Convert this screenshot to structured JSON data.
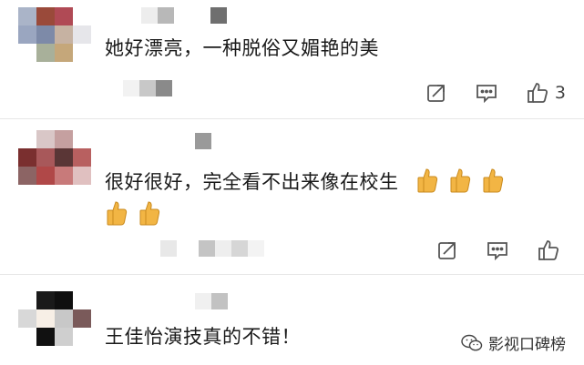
{
  "comments": [
    {
      "text": "她好漂亮，一种脱俗又媚艳的美",
      "likes": "3",
      "thumb_emojis": 0
    },
    {
      "text": "很好很好，完全看不出来像在校生",
      "likes": "",
      "thumb_emojis": 5
    },
    {
      "text": "王佳怡演技真的不错！",
      "likes": "",
      "thumb_emojis": 0
    }
  ],
  "icons": {
    "share": "share-icon",
    "reply": "comment-icon",
    "like": "thumbs-up-icon",
    "thumb_emoji": "thumbs-up-emoji"
  },
  "watermark": {
    "text": "影视口碑榜",
    "icon": "wechat-icon"
  },
  "colors": {
    "text": "#1a1a1a",
    "icon": "#555555",
    "divider": "#e6e6e6",
    "emoji": "#f2b544"
  }
}
